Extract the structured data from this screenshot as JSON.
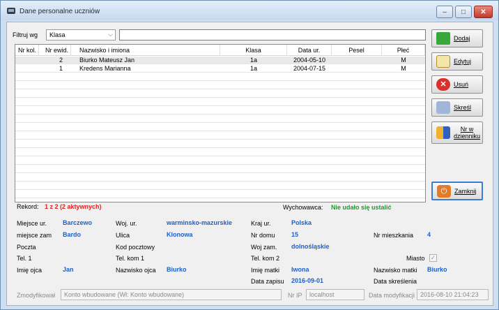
{
  "window": {
    "title": "Dane personalne uczniów"
  },
  "filter": {
    "label": "Filtruj wg",
    "selected": "Klasa",
    "text": ""
  },
  "table": {
    "headers": [
      "Nr kol.",
      "Nr ewid.",
      "Nazwisko i imiona",
      "Klasa",
      "Data ur.",
      "Pesel",
      "Płeć"
    ],
    "rows": [
      {
        "nr_kol": "",
        "nr_ewid": "2",
        "nazwisko": "Biurko Mateusz Jan",
        "klasa": "1a",
        "data_ur": "2004-05-10",
        "pesel": "",
        "plec": "M"
      },
      {
        "nr_kol": "",
        "nr_ewid": "1",
        "nazwisko": "Kredens Marianna",
        "klasa": "1a",
        "data_ur": "2004-07-15",
        "pesel": "",
        "plec": "M"
      }
    ]
  },
  "buttons": {
    "add": "Dodaj",
    "edit": "Edytuj",
    "delete": "Usuń",
    "strike": "Skreśl",
    "number": "Nr w\ndzienniku",
    "close": "Zamknij"
  },
  "status": {
    "record_label": "Rekord:",
    "record_value": "1 z 2 (2 aktywnych)",
    "tutor_label": "Wychowawca:",
    "tutor_value": "Nie udało się ustalić"
  },
  "details": {
    "miejsce_ur_label": "Miejsce ur.",
    "miejsce_ur": "Barczewo",
    "woj_ur_label": "Woj. ur.",
    "woj_ur": "warminsko-mazurskie",
    "kraj_ur_label": "Kraj ur.",
    "kraj_ur": "Polska",
    "miejsce_zam_label": "miejsce zam",
    "miejsce_zam": "Bardo",
    "ulica_label": "Ulica",
    "ulica": "Klonowa",
    "nr_domu_label": "Nr domu",
    "nr_domu": "15",
    "nr_mieszkania_label": "Nr mieszkania",
    "nr_mieszkania": "4",
    "poczta_label": "Poczta",
    "kod_label": "Kod pocztowy",
    "woj_zam_label": "Woj zam.",
    "woj_zam": "dolnośląskie",
    "tel1_label": "Tel. 1",
    "telkom1_label": "Tel. kom 1",
    "telkom2_label": "Tel. kom 2",
    "miasto_label": "Miasto",
    "imie_ojca_label": "Imię ojca",
    "imie_ojca": "Jan",
    "nazwisko_ojca_label": "Nazwisko ojca",
    "nazwisko_ojca": "Biurko",
    "imie_matki_label": "Imię matki",
    "imie_matki": "Iwona",
    "nazwisko_matki_label": "Nazwisko matki",
    "nazwisko_matki": "Biurko",
    "data_zapisu_label": "Data zapisu",
    "data_zapisu": "2016-09-01",
    "data_skreslenia_label": "Data skreślenia"
  },
  "footer": {
    "modified_label": "Zmodyfikował",
    "modified_value": "Konto wbudowane (Wł: Konto wbudowane)",
    "ip_label": "Nr IP",
    "ip_value": "localhost",
    "date_label": "Data modyfikacji",
    "date_value": "2016-08-10 21:04:23"
  },
  "colors": {
    "value_blue": "#1f5fc8",
    "record_red": "#e02020",
    "tutor_green": "#1f9a2a"
  }
}
